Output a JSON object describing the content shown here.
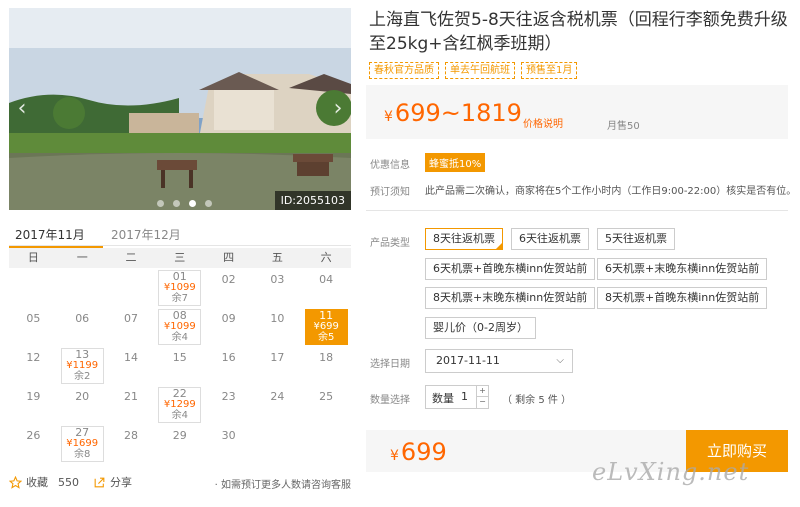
{
  "gallery": {
    "image_id": "ID:2055103",
    "prev_icon": "chevron-left-icon",
    "next_icon": "chevron-right-icon",
    "slides": 4,
    "active_slide": 3
  },
  "calendar": {
    "tabs": [
      "2017年11月",
      "2017年12月"
    ],
    "active_tab": 0,
    "weekdays": [
      "日",
      "一",
      "二",
      "三",
      "四",
      "五",
      "六"
    ],
    "days": [
      {
        "d": ""
      },
      {
        "d": ""
      },
      {
        "d": ""
      },
      {
        "d": "01",
        "p": "¥1099",
        "s": "余7"
      },
      {
        "d": "02"
      },
      {
        "d": "03"
      },
      {
        "d": "04"
      },
      {
        "d": "05"
      },
      {
        "d": "06"
      },
      {
        "d": "07"
      },
      {
        "d": "08",
        "p": "¥1099",
        "s": "余4"
      },
      {
        "d": "09"
      },
      {
        "d": "10"
      },
      {
        "d": "11",
        "p": "¥699",
        "s": "余5",
        "selected": true
      },
      {
        "d": "12"
      },
      {
        "d": "13",
        "p": "¥1199",
        "s": "余2"
      },
      {
        "d": "14"
      },
      {
        "d": "15"
      },
      {
        "d": "16"
      },
      {
        "d": "17"
      },
      {
        "d": "18"
      },
      {
        "d": "19"
      },
      {
        "d": "20"
      },
      {
        "d": "21"
      },
      {
        "d": "22",
        "p": "¥1299",
        "s": "余4"
      },
      {
        "d": "23"
      },
      {
        "d": "24"
      },
      {
        "d": "25"
      },
      {
        "d": "26"
      },
      {
        "d": "27",
        "p": "¥1699",
        "s": "余8"
      },
      {
        "d": "28"
      },
      {
        "d": "29"
      },
      {
        "d": "30"
      },
      {
        "d": ""
      },
      {
        "d": ""
      }
    ]
  },
  "actions": {
    "favorite_label": "收藏",
    "favorite_count": "550",
    "share_label": "分享",
    "tip": "· 如需预订更多人数请咨询客服"
  },
  "product": {
    "title": "上海直飞佐贺5-8天往返含税机票（回程行李额免费升级至25kg+含红枫季班期）",
    "tags": [
      "春秋官方品质",
      "单去午回航班",
      "预售至1月"
    ],
    "price_symbol": "¥",
    "price_range": "699~1819",
    "price_note": "价格说明",
    "sold": "月售50",
    "promo_label": "优惠信息",
    "promo_badge": "蜂蜜抵10%",
    "booking_label": "预订须知",
    "booking_note": "此产品需二次确认，商家将在5个工作小时内（工作日9:00-22:00）核实是否有位。",
    "type_label": "产品类型",
    "options": [
      "8天往返机票",
      "6天往返机票",
      "5天往返机票",
      "6天机票+首晚东横inn佐贺站前",
      "6天机票+末晚东横inn佐贺站前",
      "8天机票+末晚东横inn佐贺站前",
      "8天机票+首晚东横inn佐贺站前",
      "婴儿价（0-2周岁）"
    ],
    "selected_option": 0,
    "date_label": "选择日期",
    "date_value": "2017-11-11",
    "qty_label_row": "数量选择",
    "qty_label": "数量",
    "qty_value": "1",
    "qty_left": "（ 剩余 5 件 ）",
    "total_symbol": "¥",
    "total": "699",
    "buy_label": "立即购买"
  },
  "watermark": "eLvXing.net",
  "colors": {
    "accent": "#f39800",
    "price": "#ff6600"
  }
}
